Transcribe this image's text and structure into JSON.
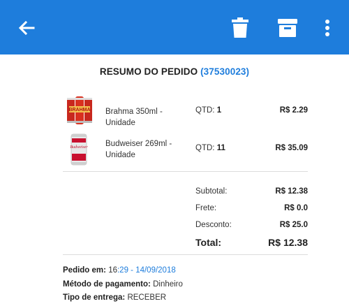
{
  "appbar": {
    "back_icon": "arrow-left-icon",
    "delete_icon": "trash-icon",
    "archive_icon": "archive-box-icon",
    "more_icon": "more-vertical-icon",
    "color": "#1e7ddc"
  },
  "summary": {
    "title": "RESUMO DO PEDIDO",
    "order_id": "(37530023)"
  },
  "products": [
    {
      "name": "Brahma 350ml - Unidade",
      "qty_label": "QTD:",
      "qty": "1",
      "price": "R$ 2.29",
      "image": "brahma-can-pack"
    },
    {
      "name": "Budweiser 269ml - Unidade",
      "qty_label": "QTD:",
      "qty": "11",
      "price": "R$ 35.09",
      "image": "budweiser-can"
    }
  ],
  "totals": {
    "subtotal_label": "Subtotal:",
    "subtotal": "R$ 12.38",
    "frete_label": "Frete:",
    "frete": "R$ 0.0",
    "desconto_label": "Desconto:",
    "desconto": "R$ 25.0",
    "total_label": "Total:",
    "total": "R$ 12.38"
  },
  "details": {
    "pedido_em_label": "Pedido em:",
    "pedido_em_hour": "16",
    "pedido_em_rest": ":29 - 14/09/2018",
    "pagamento_label": "Método de pagamento:",
    "pagamento": "Dinheiro",
    "entrega_label": "Tipo de entrega:",
    "entrega": "RECEBER"
  }
}
